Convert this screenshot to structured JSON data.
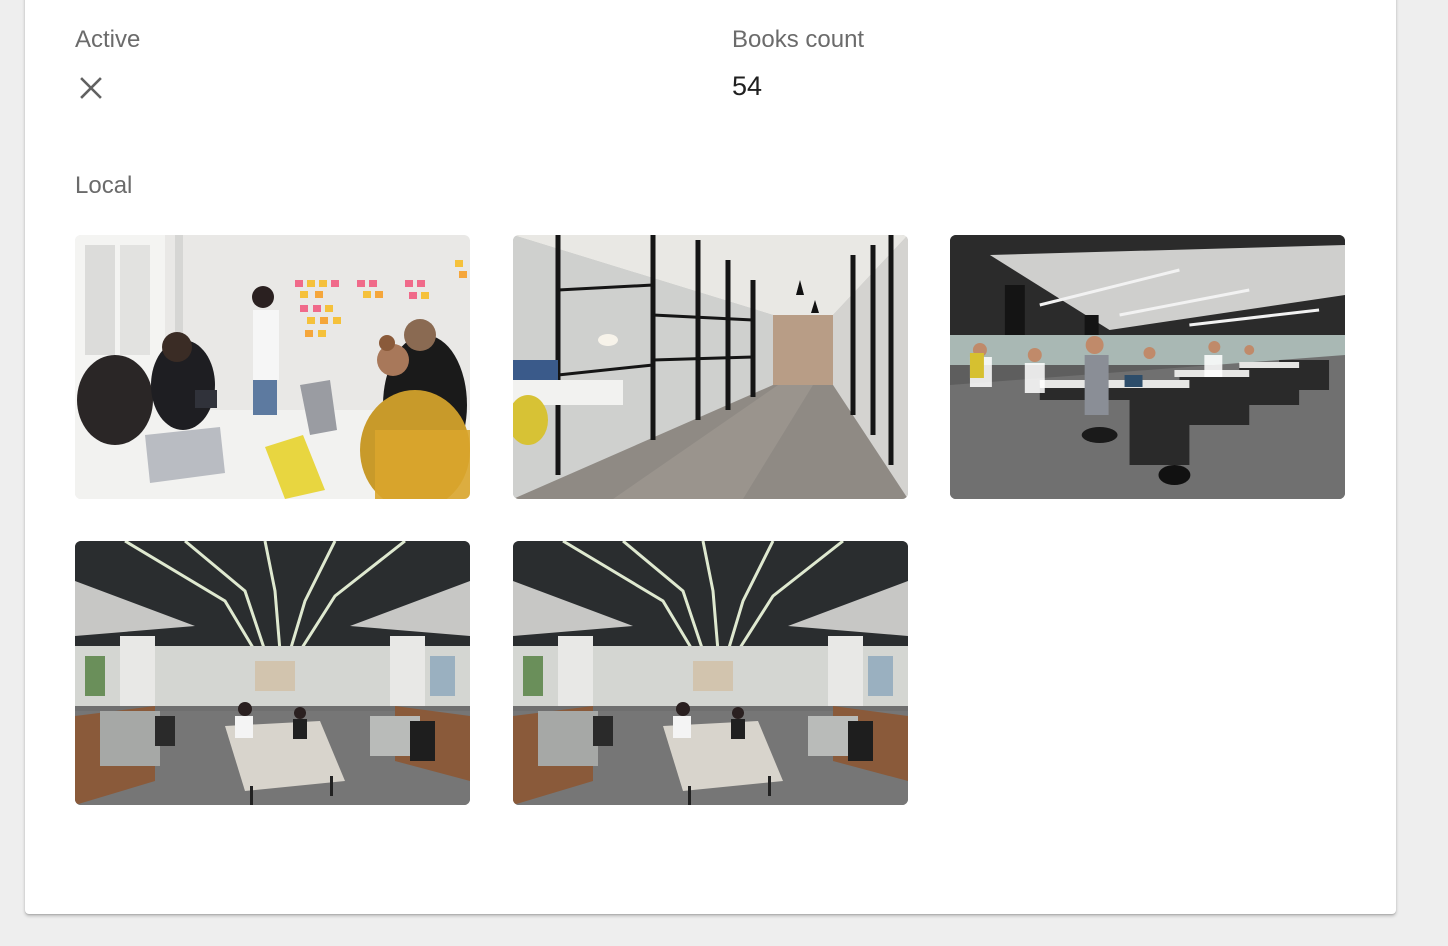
{
  "fields": {
    "active": {
      "label": "Active",
      "value_icon": "close-icon",
      "value": false
    },
    "books_count": {
      "label": "Books count",
      "value": "54"
    },
    "local": {
      "label": "Local"
    }
  },
  "gallery": {
    "images": [
      {
        "icon": "meeting-photo",
        "scene": "meeting-room"
      },
      {
        "icon": "corridor-photo",
        "scene": "glass-corridor"
      },
      {
        "icon": "open-office-photo",
        "scene": "crowded-open-office"
      },
      {
        "icon": "office-hall-photo",
        "scene": "open-office-hall"
      },
      {
        "icon": "office-hall-photo",
        "scene": "open-office-hall"
      }
    ]
  },
  "colors": {
    "background": "#eeeeee",
    "card": "#ffffff",
    "label": "#6b6b6b",
    "value": "#202020",
    "icon": "#616161"
  }
}
